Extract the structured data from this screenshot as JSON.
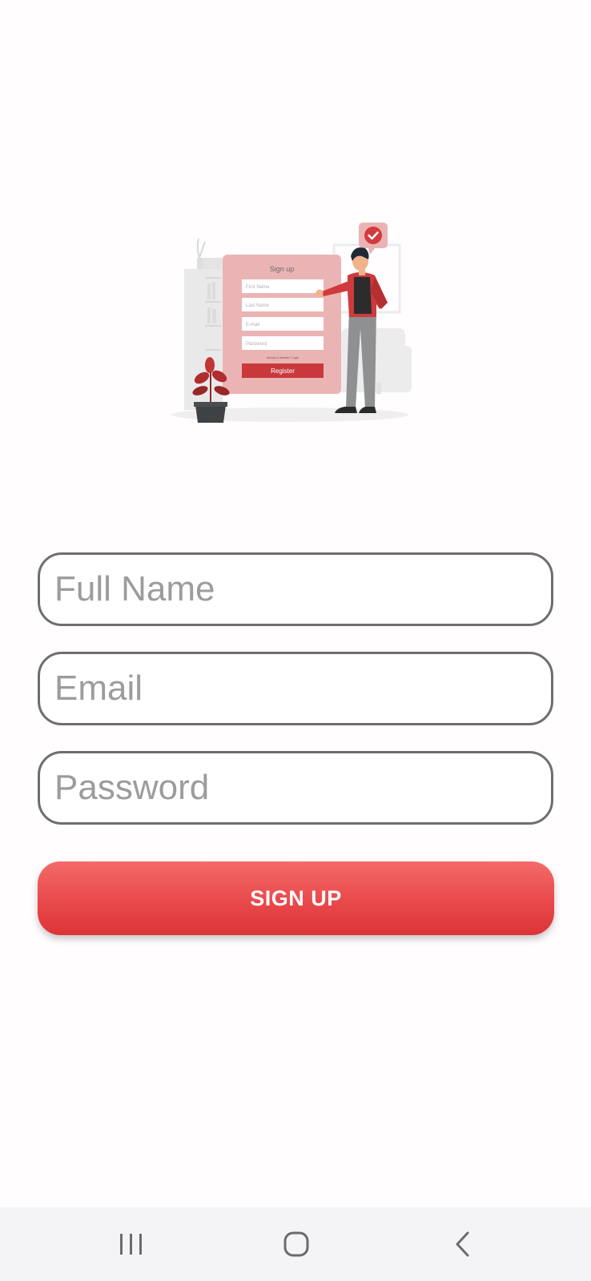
{
  "illustration": {
    "title": "Sign up",
    "fields": [
      "First Name",
      "Last Name",
      "E-mail",
      "Password"
    ],
    "small_text": "Already a member? Login",
    "button": "Register"
  },
  "form": {
    "full_name": {
      "placeholder": "Full Name",
      "value": ""
    },
    "email": {
      "placeholder": "Email",
      "value": ""
    },
    "password": {
      "placeholder": "Password",
      "value": ""
    },
    "submit_label": "SIGN UP"
  },
  "navbar": {
    "items": [
      "recents-icon",
      "home-icon",
      "back-icon"
    ]
  },
  "colors": {
    "accent": "#e84a4c",
    "card": "#ebb4b4",
    "field_border": "#6e6e6e",
    "placeholder": "#9c9c9c",
    "navbar": "#f4f4f6"
  }
}
